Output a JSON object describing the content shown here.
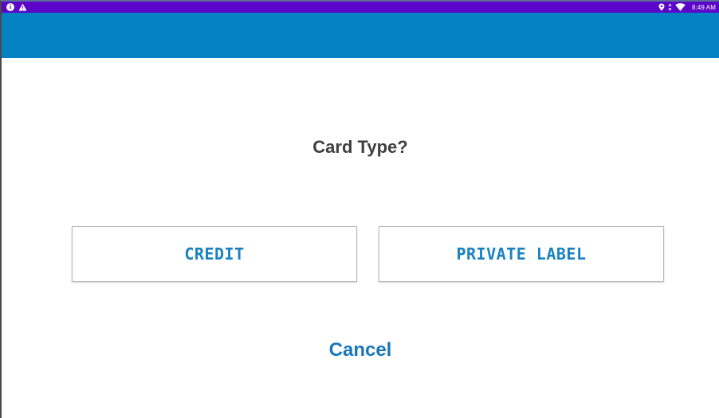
{
  "status_bar": {
    "time": "8:49 AM",
    "left_icons": [
      "info-icon",
      "warning-icon"
    ],
    "right_icons": [
      "location-icon",
      "data-arrows-icon",
      "wifi-icon"
    ],
    "background": "#5b05c9"
  },
  "app_bar": {
    "color": "#0582c4"
  },
  "prompt": {
    "text": "Card Type?"
  },
  "options": {
    "credit_label": "CREDIT",
    "private_label_label": "PRIVATE LABEL"
  },
  "cancel": {
    "label": "Cancel"
  },
  "colors": {
    "accent_text": "#1a82c0",
    "prompt_text": "#3f3f3f"
  }
}
